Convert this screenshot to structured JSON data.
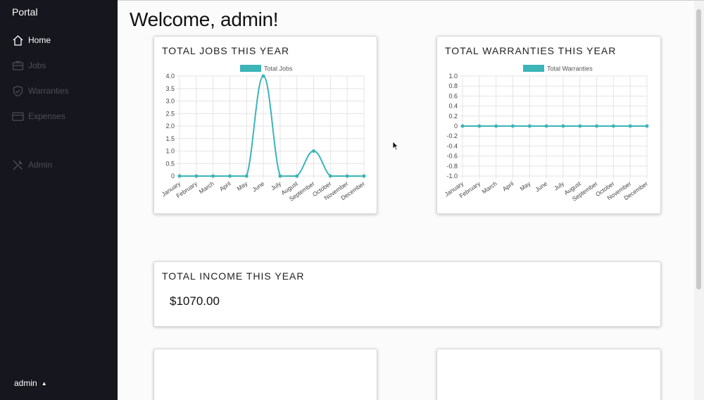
{
  "app": {
    "brand": "Portal",
    "user": "admin"
  },
  "sidebar": {
    "items": [
      {
        "label": "Home",
        "icon": "home-icon",
        "active": true
      },
      {
        "label": "Jobs",
        "icon": "jobs-icon",
        "active": false
      },
      {
        "label": "Warranties",
        "icon": "shield-icon",
        "active": false
      },
      {
        "label": "Expenses",
        "icon": "card-icon",
        "active": false
      },
      {
        "label": "Admin",
        "icon": "tools-icon",
        "active": false
      }
    ]
  },
  "page": {
    "title": "Welcome, admin!"
  },
  "cards": {
    "jobs": {
      "title": "TOTAL JOBS THIS YEAR"
    },
    "warranties": {
      "title": "TOTAL WARRANTIES THIS YEAR"
    },
    "income": {
      "title": "TOTAL INCOME THIS YEAR",
      "value": "$1070.00"
    }
  },
  "colors": {
    "accent": "#3cb4b8",
    "sidebar": "#16161e"
  },
  "chart_data": [
    {
      "type": "line",
      "categories": [
        "January",
        "February",
        "March",
        "April",
        "May",
        "June",
        "July",
        "August",
        "September",
        "October",
        "November",
        "December"
      ],
      "series": [
        {
          "name": "Total Jobs",
          "values": [
            0,
            0,
            0,
            0,
            0,
            4,
            0,
            0,
            1,
            0,
            0,
            0
          ]
        }
      ],
      "ylim": [
        0,
        4
      ],
      "yticks": [
        "4.0",
        "3.5",
        "3.0",
        "2.5",
        "2.0",
        "1.5",
        "1.0",
        "0.5",
        "0"
      ],
      "legend": "top",
      "grid": true
    },
    {
      "type": "line",
      "categories": [
        "January",
        "February",
        "March",
        "April",
        "May",
        "June",
        "July",
        "August",
        "September",
        "October",
        "November",
        "December"
      ],
      "series": [
        {
          "name": "Total Warranties",
          "values": [
            0,
            0,
            0,
            0,
            0,
            0,
            0,
            0,
            0,
            0,
            0,
            0
          ]
        }
      ],
      "ylim": [
        -1,
        1
      ],
      "yticks": [
        "1.0",
        "0.8",
        "0.6",
        "0.4",
        "0.2",
        "0",
        "-0.2",
        "-0.4",
        "-0.6",
        "-0.8",
        "-1.0"
      ],
      "legend": "top",
      "grid": true
    }
  ]
}
